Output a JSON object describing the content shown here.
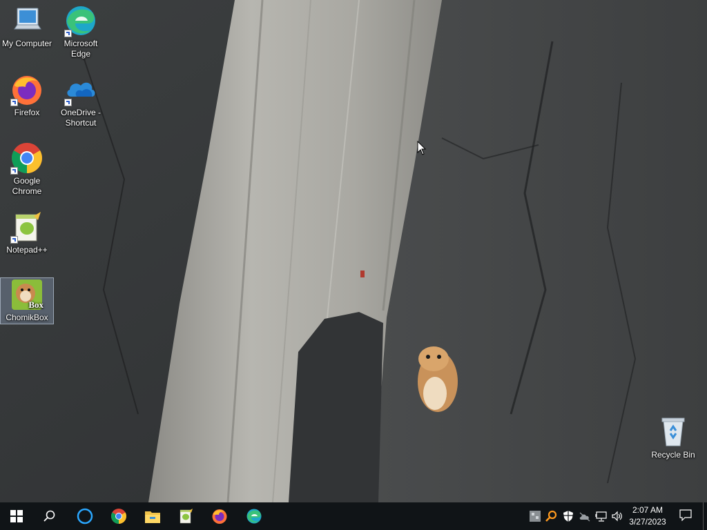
{
  "desktop": {
    "icons": [
      {
        "label": "My Computer",
        "icon": "computer-icon"
      },
      {
        "label": "Microsoft Edge",
        "icon": "edge-icon"
      },
      {
        "label": "Firefox",
        "icon": "firefox-icon"
      },
      {
        "label": "OneDrive - Shortcut",
        "icon": "onedrive-icon"
      },
      {
        "label": "Google Chrome",
        "icon": "chrome-icon"
      },
      {
        "label": "Notepad++",
        "icon": "notepadpp-icon"
      },
      {
        "label": "ChomikBox",
        "icon": "chomikbox-icon",
        "selected": true
      },
      {
        "label": "Recycle Bin",
        "icon": "recycle-bin-icon"
      }
    ],
    "chomikbox_badge": "Box"
  },
  "taskbar": {
    "pinned": [
      "start-icon",
      "search-icon",
      "cortana-icon",
      "chrome-icon",
      "file-explorer-icon",
      "notepadpp-icon",
      "firefox-icon",
      "edge-icon"
    ],
    "tray": [
      "chomikbox-tray-icon",
      "search-tray-icon",
      "security-shield-icon",
      "network-cloud-icon",
      "network-icon",
      "volume-icon"
    ],
    "clock_time": "2:07 AM",
    "clock_date": "3/27/2023"
  },
  "colors": {
    "taskbar_bg": "#101417",
    "accent": "#0078d7"
  }
}
